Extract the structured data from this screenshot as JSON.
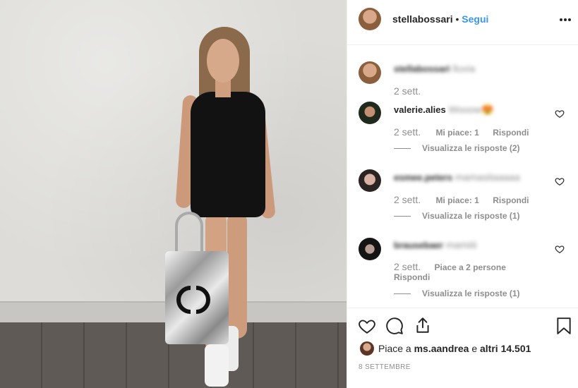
{
  "post": {
    "author": "stellabossari",
    "separator": "•",
    "follow_label": "Segui",
    "more_label": "•••"
  },
  "comments": [
    {
      "user": "stellabossari",
      "text": "lluvia",
      "time": "2 sett.",
      "likes": "",
      "reply_label": "",
      "view_replies": ""
    },
    {
      "user": "valerie.alies",
      "text": "Wooow😍",
      "time": "2 sett.",
      "likes": "Mi piace: 1",
      "reply_label": "Rispondi",
      "view_replies": "Visualizza le risposte (2)"
    },
    {
      "user": "esmee.peters",
      "text": "mamasitaaaaa",
      "time": "2 sett.",
      "likes": "Mi piace: 1",
      "reply_label": "Rispondi",
      "view_replies": "Visualizza le risposte (1)"
    },
    {
      "user": "brausebaer",
      "text": "mamiiii",
      "time": "2 sett.",
      "likes": "Piace a 2 persone",
      "reply_label": "Rispondi",
      "view_replies": "Visualizza le risposte (1)"
    }
  ],
  "likes_summary": {
    "prefix": "Piace a",
    "user": "ms.aandrea",
    "middle": "e",
    "others": "altri 14.501"
  },
  "date": "8 SETTEMBRE",
  "colors": {
    "link": "#3897f0",
    "text": "#262626",
    "muted": "#8e8e8e"
  },
  "icons": [
    "heart-icon",
    "comment-icon",
    "share-icon",
    "bookmark-icon",
    "more-icon"
  ]
}
